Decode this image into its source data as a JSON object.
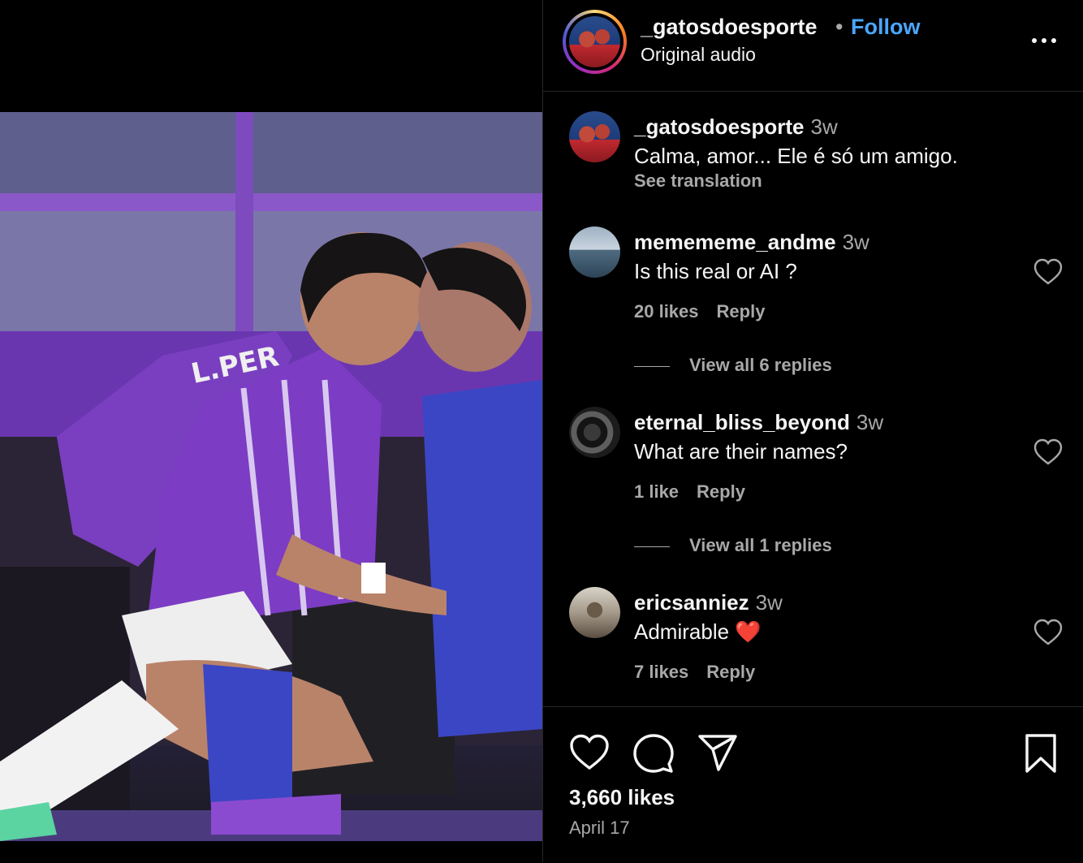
{
  "post": {
    "username": "_gatosdoesporte",
    "follow_label": "Follow",
    "audio": "Original audio",
    "likes": "3,660 likes",
    "date": "April 17",
    "video_text": "L.PER"
  },
  "caption": {
    "username": "_gatosdoesporte",
    "time": "3w",
    "text": "Calma, amor... Ele é só um amigo.",
    "see_translation": "See translation"
  },
  "comments": [
    {
      "username": "memememe_andme",
      "time": "3w",
      "text": "Is this real or AI ?",
      "likes": "20 likes",
      "reply": "Reply",
      "view_replies": "View all 6 replies"
    },
    {
      "username": "eternal_bliss_beyond",
      "time": "3w",
      "text": "What are their names?",
      "likes": "1 like",
      "reply": "Reply",
      "view_replies": "View all 1 replies"
    },
    {
      "username": "ericsanniez",
      "time": "3w",
      "text": "Admirable ❤️",
      "likes": "7 likes",
      "reply": "Reply"
    }
  ],
  "icons": {
    "more": "more-horizontal-icon",
    "like": "heart-icon",
    "comment": "comment-icon",
    "share": "paper-plane-icon",
    "save": "bookmark-icon"
  },
  "colors": {
    "accent": "#4aa6ff",
    "muted": "#a8a8a8",
    "background": "#000000"
  }
}
